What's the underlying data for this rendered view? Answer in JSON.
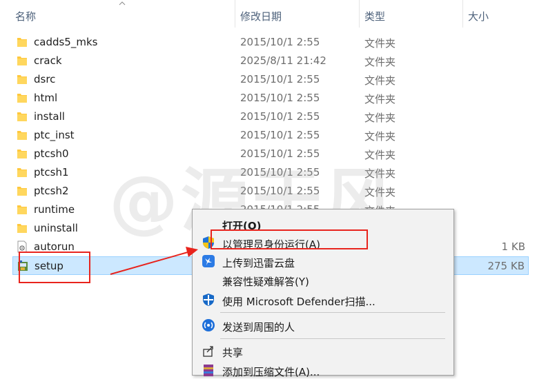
{
  "header": {
    "name": "名称",
    "date": "修改日期",
    "type": "类型",
    "size": "大小"
  },
  "files": [
    {
      "name": "cadds5_mks",
      "date": "2015/10/1 2:55",
      "type": "文件夹",
      "size": "",
      "icon": "folder-icon"
    },
    {
      "name": "crack",
      "date": "2025/8/11 21:42",
      "type": "文件夹",
      "size": "",
      "icon": "folder-icon"
    },
    {
      "name": "dsrc",
      "date": "2015/10/1 2:55",
      "type": "文件夹",
      "size": "",
      "icon": "folder-icon"
    },
    {
      "name": "html",
      "date": "2015/10/1 2:55",
      "type": "文件夹",
      "size": "",
      "icon": "folder-icon"
    },
    {
      "name": "install",
      "date": "2015/10/1 2:55",
      "type": "文件夹",
      "size": "",
      "icon": "folder-icon"
    },
    {
      "name": "ptc_inst",
      "date": "2015/10/1 2:55",
      "type": "文件夹",
      "size": "",
      "icon": "folder-icon"
    },
    {
      "name": "ptcsh0",
      "date": "2015/10/1 2:55",
      "type": "文件夹",
      "size": "",
      "icon": "folder-icon"
    },
    {
      "name": "ptcsh1",
      "date": "2015/10/1 2:55",
      "type": "文件夹",
      "size": "",
      "icon": "folder-icon"
    },
    {
      "name": "ptcsh2",
      "date": "2015/10/1 2:55",
      "type": "文件夹",
      "size": "",
      "icon": "folder-icon"
    },
    {
      "name": "runtime",
      "date": "2015/10/1 2:55",
      "type": "文件夹",
      "size": "",
      "icon": "folder-icon"
    },
    {
      "name": "uninstall",
      "date": "",
      "type": "",
      "size": "",
      "icon": "folder-icon"
    },
    {
      "name": "autorun",
      "date": "",
      "type": "",
      "size": "1 KB",
      "icon": "settings-file-icon"
    },
    {
      "name": "setup",
      "date": "",
      "type": "",
      "size": "275 KB",
      "icon": "installer-icon",
      "selected": true
    }
  ],
  "watermark": "@源于风",
  "context_menu": {
    "items": [
      {
        "label": "打开(O)",
        "bold": true,
        "icon": ""
      },
      {
        "label": "以管理员身份运行(A)",
        "icon": "uac-shield-icon"
      },
      {
        "label": "上传到迅雷云盘",
        "icon": "thunder-cloud-icon"
      },
      {
        "label": "兼容性疑难解答(Y)",
        "icon": ""
      },
      {
        "label": "使用 Microsoft Defender扫描...",
        "icon": "defender-shield-icon"
      },
      {
        "label": "发送到周围的人",
        "icon": "nearby-share-icon"
      },
      {
        "label": "共享",
        "icon": "share-icon"
      },
      {
        "label": "添加到压缩文件(A)...",
        "icon": "winrar-icon"
      }
    ]
  },
  "colors": {
    "selection_bg": "#cce8ff",
    "selection_border": "#99d1ff",
    "annotation_red": "#e8231c",
    "folder_yellow": "#ffca28"
  }
}
